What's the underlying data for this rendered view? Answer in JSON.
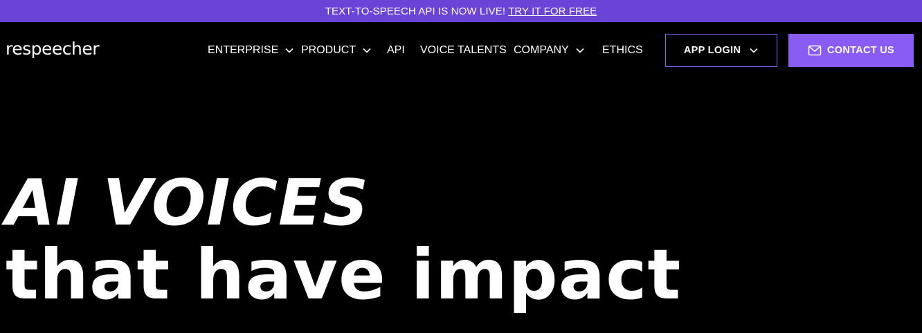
{
  "announcement": {
    "text": "TEXT-TO-SPEECH API IS NOW LIVE!",
    "link": "TRY IT FOR FREE"
  },
  "header": {
    "logo": "respeecher",
    "nav": [
      {
        "label": "ENTERPRISE",
        "has_dropdown": true
      },
      {
        "label": "PRODUCT",
        "has_dropdown": true
      },
      {
        "label": "API",
        "has_dropdown": false
      },
      {
        "label": "VOICE TALENTS",
        "has_dropdown": false
      },
      {
        "label": "COMPANY",
        "has_dropdown": true
      },
      {
        "label": "ETHICS",
        "has_dropdown": false
      }
    ],
    "login_label": "APP LOGIN",
    "contact_label": "CONTACT US"
  },
  "hero": {
    "line1": "AI VOICES",
    "line2": "that have impact"
  },
  "colors": {
    "announcement_bg": "#6a44d6",
    "accent": "#8a5cf6",
    "background": "#000000",
    "text": "#ffffff"
  },
  "icons": {
    "dropdown": "chevron-down-icon",
    "contact": "mail-icon"
  }
}
